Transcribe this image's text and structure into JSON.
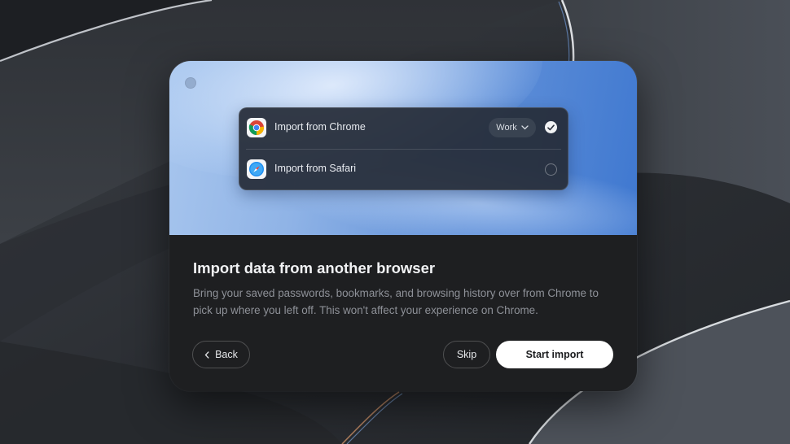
{
  "colors": {
    "dialog_bg": "#1e1f21",
    "hero_blue": "#3f78d0",
    "primary_button_bg": "#ffffff",
    "muted_text": "#8e9198"
  },
  "import_panel": {
    "options": [
      {
        "label": "Import from Chrome",
        "icon": "chrome-icon",
        "profile": "Work",
        "selected": true
      },
      {
        "label": "Import from Safari",
        "icon": "safari-icon",
        "selected": false
      }
    ]
  },
  "content": {
    "title": "Import data from another browser",
    "description": "Bring your saved passwords, bookmarks, and browsing history over from Chrome to pick up where you left off. This won't affect your experience on Chrome."
  },
  "actions": {
    "back_label": "Back",
    "skip_label": "Skip",
    "start_label": "Start import"
  }
}
